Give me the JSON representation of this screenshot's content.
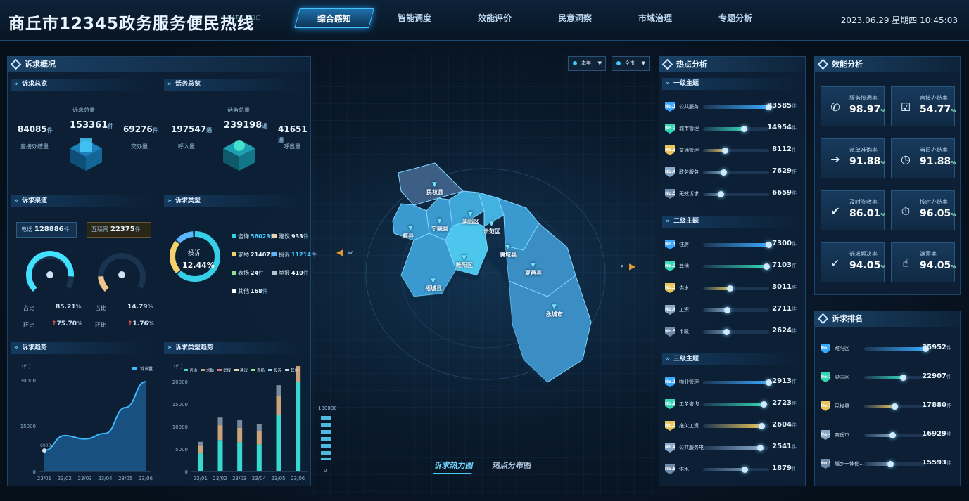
{
  "header": {
    "title": "商丘市12345政务服务便民热线",
    "sub": "+ DATA",
    "tabs": [
      "综合感知",
      "智能调度",
      "效能评价",
      "民意洞察",
      "市域治理",
      "专题分析"
    ],
    "datetime": "2023.06.29 星期四  10:45:03"
  },
  "left": {
    "title": "诉求概况",
    "overview": {
      "title": "诉求总览",
      "total_label": "诉求总量",
      "total": "153361",
      "unit": "件",
      "direct": "84085",
      "direct_label": "直接办结量",
      "transfer": "69276",
      "transfer_label": "交办量"
    },
    "calls": {
      "title": "话务总览",
      "total_label": "话务总量",
      "total": "239198",
      "unit": "通",
      "in": "197547",
      "in_label": "呼入量",
      "out": "41651",
      "out_label": "呼出量"
    },
    "channels": {
      "title": "诉求渠道",
      "phone_label": "电话",
      "phone": "128886",
      "internet_label": "互联网",
      "internet": "22375",
      "unit": "件",
      "ratio_label": "占比",
      "yoy_label": "环比",
      "phone_ratio": "85.21",
      "phone_yoy": "75.70",
      "internet_ratio": "14.79",
      "internet_yoy": "1.76",
      "pct": "%",
      "phone_level": 0.85,
      "internet_level": 0.15
    },
    "types": {
      "title": "诉求类型",
      "center_label": "投诉",
      "center_value": "12.44%",
      "items": [
        {
          "name": "咨询",
          "value": "56023",
          "unit": "件",
          "color": "#35d0e8"
        },
        {
          "name": "建议",
          "value": "933",
          "unit": "件",
          "color": "#e8d2b0"
        },
        {
          "name": "求助",
          "value": "21407",
          "unit": "件",
          "color": "#f2d06a"
        },
        {
          "name": "投诉",
          "value": "11214",
          "unit": "件",
          "color": "#5ab6ff"
        },
        {
          "name": "表扬",
          "value": "24",
          "unit": "件",
          "color": "#8fe08f"
        },
        {
          "name": "举报",
          "value": "410",
          "unit": "件",
          "color": "#b8c4d0"
        },
        {
          "name": "其他",
          "value": "168",
          "unit": "件",
          "color": "#ffffff"
        }
      ]
    },
    "trend": {
      "title": "诉求趋势",
      "ylab": "(件)",
      "legend": "诉求量",
      "peak_label": "6903"
    },
    "typetrend": {
      "title": "诉求类型趋势",
      "ylab": "(件)",
      "legend": [
        "咨询",
        "求助",
        "举报",
        "建议",
        "表扬",
        "投诉",
        "其他"
      ]
    }
  },
  "chart_data": [
    {
      "type": "area",
      "title": "诉求趋势",
      "x": [
        "23/01",
        "23/02",
        "23/03",
        "23/04",
        "23/05",
        "23/06"
      ],
      "series": [
        {
          "name": "诉求量",
          "values": [
            6903,
            11800,
            10700,
            12500,
            21000,
            29500
          ]
        }
      ],
      "ylim": [
        0,
        30000
      ],
      "yticks": [
        0,
        15000,
        30000
      ]
    },
    {
      "type": "bar",
      "title": "诉求类型趋势",
      "categories": [
        "23/01",
        "23/02",
        "23/03",
        "23/04",
        "23/05",
        "23/06"
      ],
      "series": [
        {
          "name": "咨询",
          "values": [
            4000,
            7000,
            6500,
            6000,
            12500,
            20000
          ]
        },
        {
          "name": "求助",
          "values": [
            1700,
            3300,
            3200,
            3000,
            4300,
            6000
          ]
        },
        {
          "name": "投诉",
          "values": [
            900,
            1700,
            1700,
            1500,
            2400,
            2900
          ]
        }
      ],
      "ylim": [
        0,
        20000
      ],
      "yticks": [
        0,
        5000,
        10000,
        15000,
        20000
      ]
    }
  ],
  "map": {
    "filters": [
      "本年",
      "全市"
    ],
    "regions": [
      "民权县",
      "睢县",
      "宁陵县",
      "梁园区",
      "示范区",
      "虞城县",
      "睢阳区",
      "柘城县",
      "夏邑县",
      "永城市"
    ],
    "tabs": [
      "诉求热力图",
      "热点分布图"
    ],
    "legend_max": "100000",
    "legend_min": "0",
    "compass": [
      "W",
      "E"
    ]
  },
  "hot": {
    "title": "热点分析",
    "groups": [
      {
        "title": "一级主题",
        "items": [
          {
            "rank": "No.1",
            "name": "公共服务",
            "value": "23585",
            "level": 1.0
          },
          {
            "rank": "No.2",
            "name": "城市管理",
            "value": "14954",
            "level": 0.63
          },
          {
            "rank": "No.3",
            "name": "交通管理",
            "value": "8112",
            "level": 0.34
          },
          {
            "rank": "No.4",
            "name": "政务服务",
            "value": "7629",
            "level": 0.32
          },
          {
            "rank": "No.5",
            "name": "无效诉求",
            "value": "6659",
            "level": 0.28
          }
        ]
      },
      {
        "title": "二级主题",
        "items": [
          {
            "rank": "No.1",
            "name": "住房",
            "value": "7300",
            "level": 1.0
          },
          {
            "rank": "No.2",
            "name": "其他",
            "value": "7103",
            "level": 0.97
          },
          {
            "rank": "No.3",
            "name": "供水",
            "value": "3011",
            "level": 0.41
          },
          {
            "rank": "No.4",
            "name": "工资",
            "value": "2711",
            "level": 0.37
          },
          {
            "rank": "No.5",
            "name": "市政",
            "value": "2624",
            "level": 0.36
          }
        ]
      },
      {
        "title": "三级主题",
        "items": [
          {
            "rank": "No.1",
            "name": "物业管理",
            "value": "2913",
            "level": 1.0
          },
          {
            "rank": "No.2",
            "name": "工单咨询",
            "value": "2723",
            "level": 0.93
          },
          {
            "rank": "No.3",
            "name": "拖欠工资",
            "value": "2604",
            "level": 0.89
          },
          {
            "rank": "No.4",
            "name": "公共服务电…",
            "value": "2541",
            "level": 0.87
          },
          {
            "rank": "No.5",
            "name": "供水",
            "value": "1879",
            "level": 0.64
          }
        ]
      }
    ],
    "unit": "件"
  },
  "perf": {
    "title": "效能分析",
    "items": [
      {
        "label": "服务接通率",
        "value": "98.97",
        "icon": "phone-icon",
        "glyph": "✆"
      },
      {
        "label": "直接办结率",
        "value": "54.77",
        "icon": "clipboard-icon",
        "glyph": "☑"
      },
      {
        "label": "派单准确率",
        "value": "91.88",
        "icon": "document-icon",
        "glyph": "➔"
      },
      {
        "label": "当日办结率",
        "value": "91.88",
        "icon": "calendar-icon",
        "glyph": "◷"
      },
      {
        "label": "及时签收率",
        "value": "86.01",
        "icon": "checklist-icon",
        "glyph": "✔"
      },
      {
        "label": "按时办结率",
        "value": "96.05",
        "icon": "timer-icon",
        "glyph": "⏱"
      },
      {
        "label": "诉求解决率",
        "value": "94.05",
        "icon": "check-circle-icon",
        "glyph": "✓"
      },
      {
        "label": "满意率",
        "value": "94.05",
        "icon": "thumbs-up-icon",
        "glyph": "☝"
      }
    ],
    "pct": "%"
  },
  "rank": {
    "title": "诉求排名",
    "unit": "件",
    "items": [
      {
        "rank": "No.1",
        "name": "睢阳区",
        "value": "35952",
        "level": 1.0
      },
      {
        "rank": "No.2",
        "name": "梁园区",
        "value": "22907",
        "level": 0.64
      },
      {
        "rank": "No.3",
        "name": "民权县",
        "value": "17880",
        "level": 0.5
      },
      {
        "rank": "No.4",
        "name": "商丘市",
        "value": "16929",
        "level": 0.47
      },
      {
        "rank": "No.5",
        "name": "城乡一体化…",
        "value": "15593",
        "level": 0.43
      }
    ]
  },
  "colors": {
    "rank1": "#3aa8ff",
    "rank2": "#36d6b4",
    "rank3": "#e8c45a",
    "rank4": "#8aa8c8",
    "rank5": "#6f8aa8"
  }
}
